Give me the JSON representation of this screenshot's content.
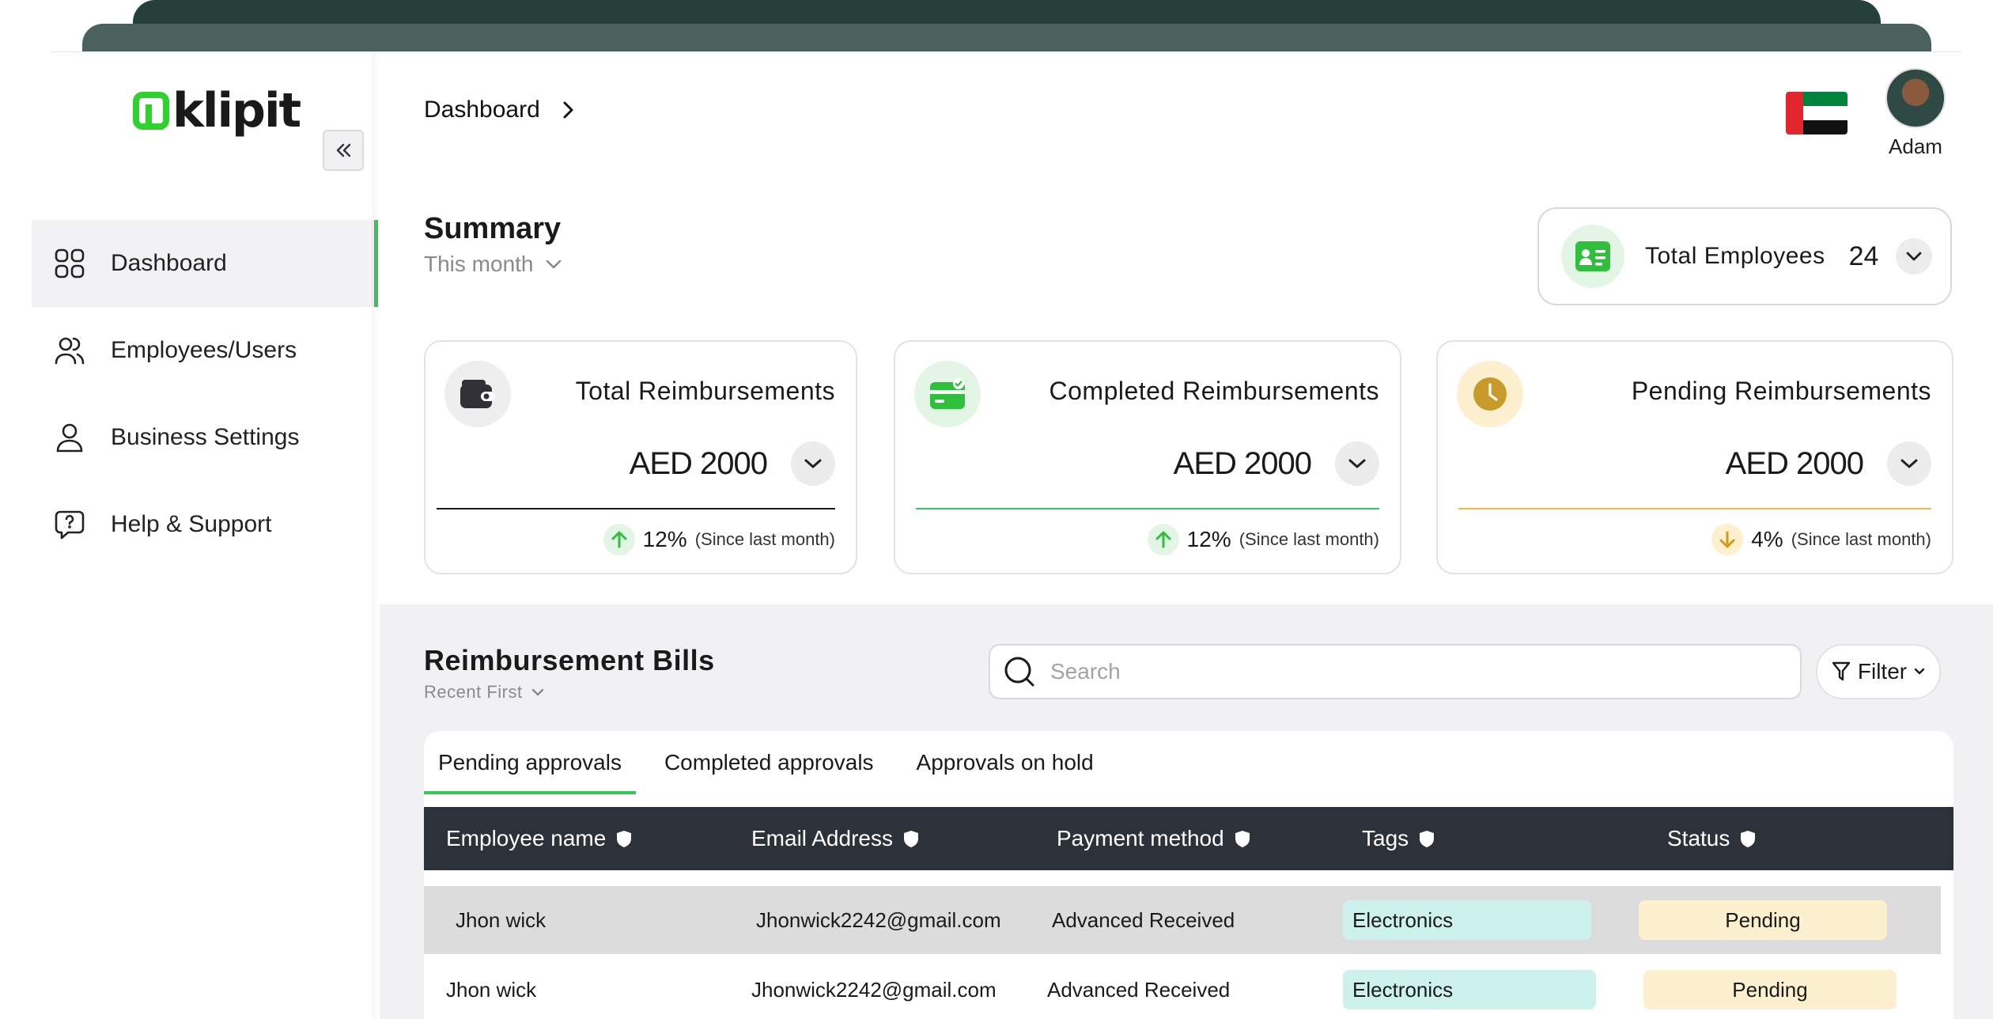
{
  "app": {
    "brand": "klipit"
  },
  "sidebar": {
    "items": [
      {
        "label": "Dashboard",
        "icon": "grid-icon",
        "active": true
      },
      {
        "label": "Employees/Users",
        "icon": "users-icon"
      },
      {
        "label": "Business Settings",
        "icon": "user-icon"
      },
      {
        "label": "Help & Support",
        "icon": "help-chat-icon"
      }
    ]
  },
  "header": {
    "breadcrumb": "Dashboard",
    "user_name": "Adam",
    "flag": "uae-flag-icon"
  },
  "summary": {
    "title": "Summary",
    "period": "This month",
    "employees": {
      "label": "Total Employees",
      "count": "24"
    },
    "cards": [
      {
        "title": "Total Reimbursements",
        "value": "AED 2000",
        "change": "12%",
        "note": "(Since last month)",
        "direction": "up",
        "accent": "#1a1a1a"
      },
      {
        "title": "Completed Reimbursements",
        "value": "AED 2000",
        "change": "12%",
        "note": "(Since last month)",
        "direction": "up",
        "accent": "#34c759"
      },
      {
        "title": "Pending Reimbursements",
        "value": "AED 2000",
        "change": "4%",
        "note": "(Since last month)",
        "direction": "down",
        "accent": "#f2b64b"
      }
    ]
  },
  "bills": {
    "title": "Reimbursement Bills",
    "sort": "Recent First",
    "search_placeholder": "Search",
    "filter_label": "Filter",
    "tabs": [
      "Pending approvals",
      "Completed approvals",
      "Approvals on hold"
    ],
    "columns": [
      "Employee name",
      "Email Address",
      "Payment method",
      "Tags",
      "Status"
    ],
    "rows": [
      {
        "name": "Jhon wick",
        "email": "Jhonwick2242@gmail.com",
        "method": "Advanced Received",
        "tag": "Electronics",
        "status": "Pending"
      },
      {
        "name": "Jhon wick",
        "email": "Jhonwick2242@gmail.com",
        "method": "Advanced Received",
        "tag": "Electronics",
        "status": "Pending"
      }
    ]
  },
  "colors": {
    "accent_green": "#34c759",
    "pending_bg": "#fcf0cf",
    "tag_bg": "#cdf1ec",
    "table_header": "#2c313a"
  }
}
